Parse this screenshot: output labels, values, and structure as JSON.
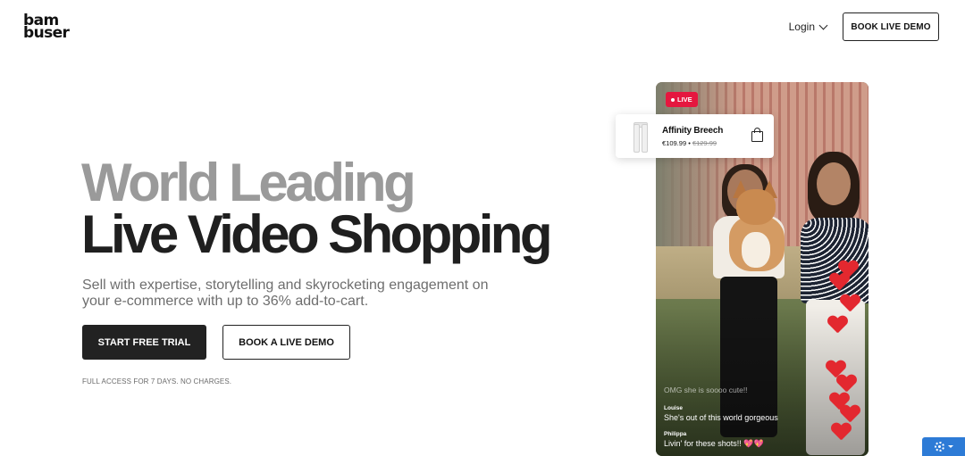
{
  "header": {
    "logo_line1": "bam",
    "logo_line2": "buser",
    "login_label": "Login",
    "book_demo_label": "BOOK LIVE DEMO"
  },
  "hero": {
    "headline_line1": "World Leading",
    "headline_line2": "Live Video Shopping",
    "subtitle": "Sell with expertise, storytelling and skyrocketing engagement on your e-commerce with up to 36% add-to-cart.",
    "primary_cta": "START FREE TRIAL",
    "secondary_cta": "BOOK A LIVE DEMO",
    "note": "FULL ACCESS FOR 7 DAYS. NO CHARGES."
  },
  "video": {
    "live_label": "LIVE",
    "product": {
      "name": "Affinity Breech",
      "price": "€109.99",
      "separator": " • ",
      "old_price": "€129.99"
    },
    "comments": {
      "faded": "OMG she is soooo cute!!",
      "items": [
        {
          "author": "Louise",
          "text": "She's out of this world gorgeous"
        },
        {
          "author": "Philippa",
          "text": "Livin' for these shots!! 💖💖"
        }
      ]
    }
  },
  "colors": {
    "live_red": "#e5173f",
    "heart_red": "#e3282f",
    "settings_blue": "#2d7bd6",
    "headline_gray": "#9a9a9a",
    "headline_dark": "#1f1f1f"
  },
  "icons": [
    "chevron-down-icon",
    "shopping-bag-icon",
    "heart-icon",
    "gear-icon"
  ]
}
